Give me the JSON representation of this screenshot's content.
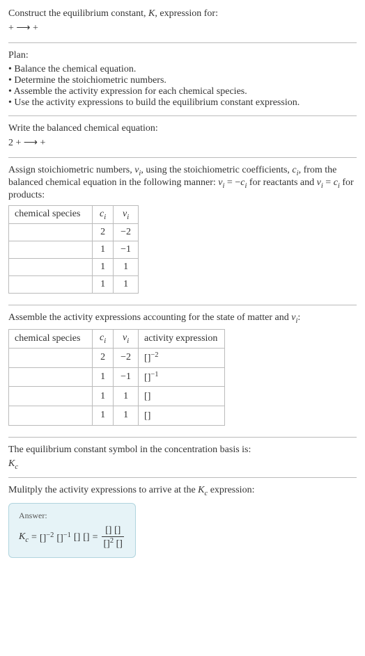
{
  "intro": {
    "line1": "Construct the equilibrium constant, ",
    "K": "K",
    "line1_suffix": ", expression for:",
    "equation": " +  ⟶  + "
  },
  "plan": {
    "heading": "Plan:",
    "items": [
      "• Balance the chemical equation.",
      "• Determine the stoichiometric numbers.",
      "• Assemble the activity expression for each chemical species.",
      "• Use the activity expressions to build the equilibrium constant expression."
    ]
  },
  "balanced": {
    "heading": "Write the balanced chemical equation:",
    "equation": "2  +  ⟶  + "
  },
  "assign": {
    "text_a": "Assign stoichiometric numbers, ",
    "nu_i": "ν",
    "nu_sub": "i",
    "text_b": ", using the stoichiometric coefficients, ",
    "c_i": "c",
    "c_sub": "i",
    "text_c": ", from the balanced chemical equation in the following manner: ",
    "eq1_lhs": "ν",
    "eq1_lhs_sub": "i",
    "eq1_mid": " = −",
    "eq1_rhs": "c",
    "eq1_rhs_sub": "i",
    "text_d": " for reactants and ",
    "eq2_lhs": "ν",
    "eq2_lhs_sub": "i",
    "eq2_mid": " = ",
    "eq2_rhs": "c",
    "eq2_rhs_sub": "i",
    "text_e": " for products:"
  },
  "table1": {
    "headers": {
      "species": "chemical species",
      "ci": "c",
      "ci_sub": "i",
      "nui": "ν",
      "nui_sub": "i"
    },
    "rows": [
      {
        "species": "",
        "ci": "2",
        "nui": "−2"
      },
      {
        "species": "",
        "ci": "1",
        "nui": "−1"
      },
      {
        "species": "",
        "ci": "1",
        "nui": "1"
      },
      {
        "species": "",
        "ci": "1",
        "nui": "1"
      }
    ]
  },
  "assemble": {
    "text_a": "Assemble the activity expressions accounting for the state of matter and ",
    "nu": "ν",
    "nu_sub": "i",
    "text_b": ":"
  },
  "table2": {
    "headers": {
      "species": "chemical species",
      "ci": "c",
      "ci_sub": "i",
      "nui": "ν",
      "nui_sub": "i",
      "activity": "activity expression"
    },
    "rows": [
      {
        "species": "",
        "ci": "2",
        "nui": "−2",
        "base": "[]",
        "exp": "−2"
      },
      {
        "species": "",
        "ci": "1",
        "nui": "−1",
        "base": "[]",
        "exp": "−1"
      },
      {
        "species": "",
        "ci": "1",
        "nui": "1",
        "base": "[]",
        "exp": ""
      },
      {
        "species": "",
        "ci": "1",
        "nui": "1",
        "base": "[]",
        "exp": ""
      }
    ]
  },
  "symbol": {
    "text": "The equilibrium constant symbol in the concentration basis is:",
    "K": "K",
    "K_sub": "c"
  },
  "multiply": {
    "text_a": "Mulitply the activity expressions to arrive at the ",
    "K": "K",
    "K_sub": "c",
    "text_b": " expression:"
  },
  "answer": {
    "label": "Answer:",
    "K": "K",
    "K_sub": "c",
    "eq": " = ",
    "term1_base": "[]",
    "term1_exp": "−2",
    "term2_base": "[]",
    "term2_exp": "−1",
    "term3": "[]",
    "term4": "[]",
    "eq2": " = ",
    "num1": "[]",
    "num2": "[]",
    "den1_base": "[]",
    "den1_exp": "2",
    "den2": "[]"
  }
}
